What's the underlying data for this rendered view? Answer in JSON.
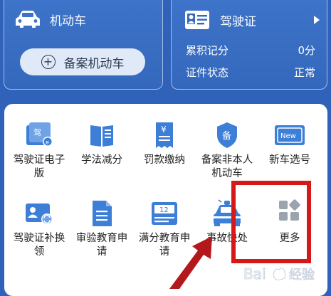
{
  "vehicle_card": {
    "title": "机动车",
    "register_button": "备案机动车"
  },
  "license_card": {
    "title": "驾驶证",
    "rows": [
      {
        "label": "累积记分",
        "value": "0分"
      },
      {
        "label": "证件状态",
        "value": "正常"
      }
    ]
  },
  "services": {
    "items": [
      {
        "label": "驾驶证电子版",
        "icon": "e-license-icon"
      },
      {
        "label": "学法减分",
        "icon": "book-icon"
      },
      {
        "label": "罚款缴纳",
        "icon": "fine-receipt-icon"
      },
      {
        "label": "备案非本人机动车",
        "icon": "shield-icon"
      },
      {
        "label": "新车选号",
        "icon": "new-plate-icon"
      },
      {
        "label": "驾驶证补换领",
        "icon": "license-renew-icon"
      },
      {
        "label": "审验教育申请",
        "icon": "document-icon"
      },
      {
        "label": "满分教育申请",
        "icon": "calendar-icon"
      },
      {
        "label": "事故快处",
        "icon": "police-car-icon"
      },
      {
        "label": "更多",
        "icon": "more-apps-icon"
      }
    ]
  },
  "new_plate_badge": "New",
  "fine_symbol": "¥",
  "calendar_number": "12",
  "shield_char": "备",
  "license_char": "驾",
  "watermark": "Bai 经验",
  "colors": {
    "icon_blue": "#3d7fd6",
    "annotation_red": "#d51818",
    "background": "#2f62b8"
  }
}
